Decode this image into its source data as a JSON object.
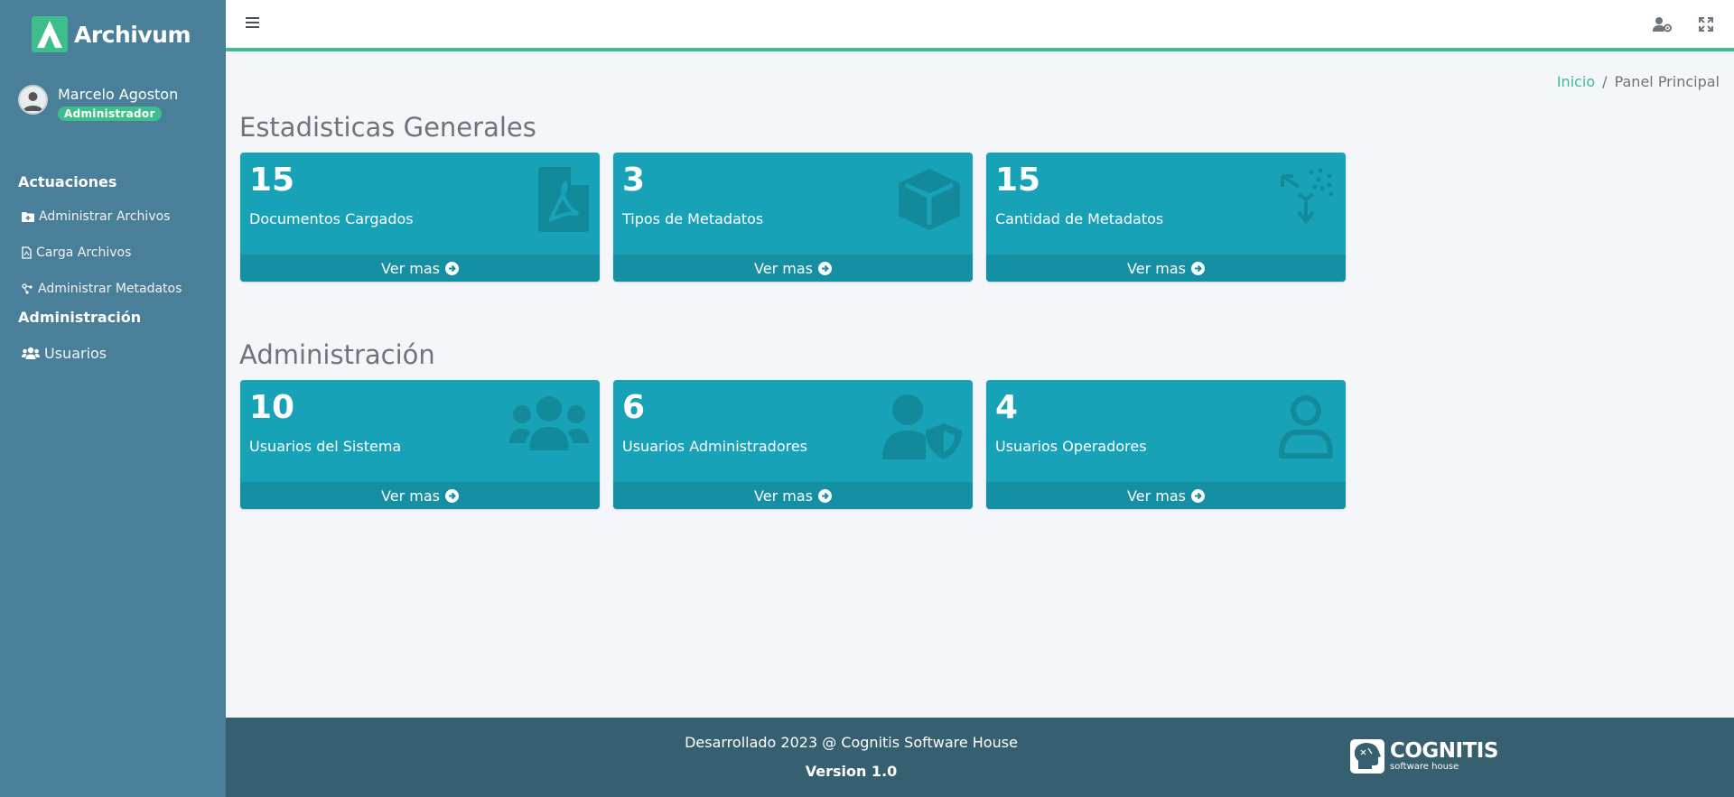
{
  "brand": {
    "name": "Archivum"
  },
  "user": {
    "name": "Marcelo Agoston",
    "role": "Administrador"
  },
  "sidebar": {
    "headers": [
      "Actuaciones",
      "Administración"
    ],
    "items": [
      {
        "label": "Administrar Archivos",
        "icon": "folder-plus-icon"
      },
      {
        "label": "Carga Archivos",
        "icon": "file-pdf-icon"
      },
      {
        "label": "Administrar Metadatos",
        "icon": "network-icon"
      },
      {
        "label": "Usuarios",
        "icon": "users-icon"
      }
    ]
  },
  "topbar": {
    "menu_icon": "hamburger-icon",
    "user_icon": "user-cog-icon",
    "expand_icon": "expand-icon"
  },
  "breadcrumb": {
    "home": "Inicio",
    "separator": "/",
    "current": "Panel Principal"
  },
  "sections": [
    {
      "title": "Estadisticas Generales",
      "boxes": [
        {
          "value": "15",
          "label": "Documentos Cargados",
          "link": "Ver mas",
          "icon": "file-pdf-icon"
        },
        {
          "value": "3",
          "label": "Tipos de Metadatos",
          "link": "Ver mas",
          "icon": "cube-icon"
        },
        {
          "value": "15",
          "label": "Cantidad de Metadatos",
          "link": "Ver mas",
          "icon": "cube-dots-icon"
        }
      ]
    },
    {
      "title": "Administración",
      "boxes": [
        {
          "value": "10",
          "label": "Usuarios del Sistema",
          "link": "Ver mas",
          "icon": "users-icon"
        },
        {
          "value": "6",
          "label": "Usuarios Administradores",
          "link": "Ver mas",
          "icon": "user-shield-icon"
        },
        {
          "value": "4",
          "label": "Usuarios Operadores",
          "link": "Ver mas",
          "icon": "user-icon"
        }
      ]
    }
  ],
  "footer": {
    "credits": "Desarrollado 2023 @ Cognitis Software House",
    "version": "Version 1.0",
    "logo_text": "COGNITIS",
    "logo_sub": "software house"
  },
  "colors": {
    "sidebar": "#4a7f9a",
    "accent": "#3ebd8d",
    "box": "#17a2b8",
    "box_footer": "#158fa3",
    "footer": "#365f70"
  }
}
